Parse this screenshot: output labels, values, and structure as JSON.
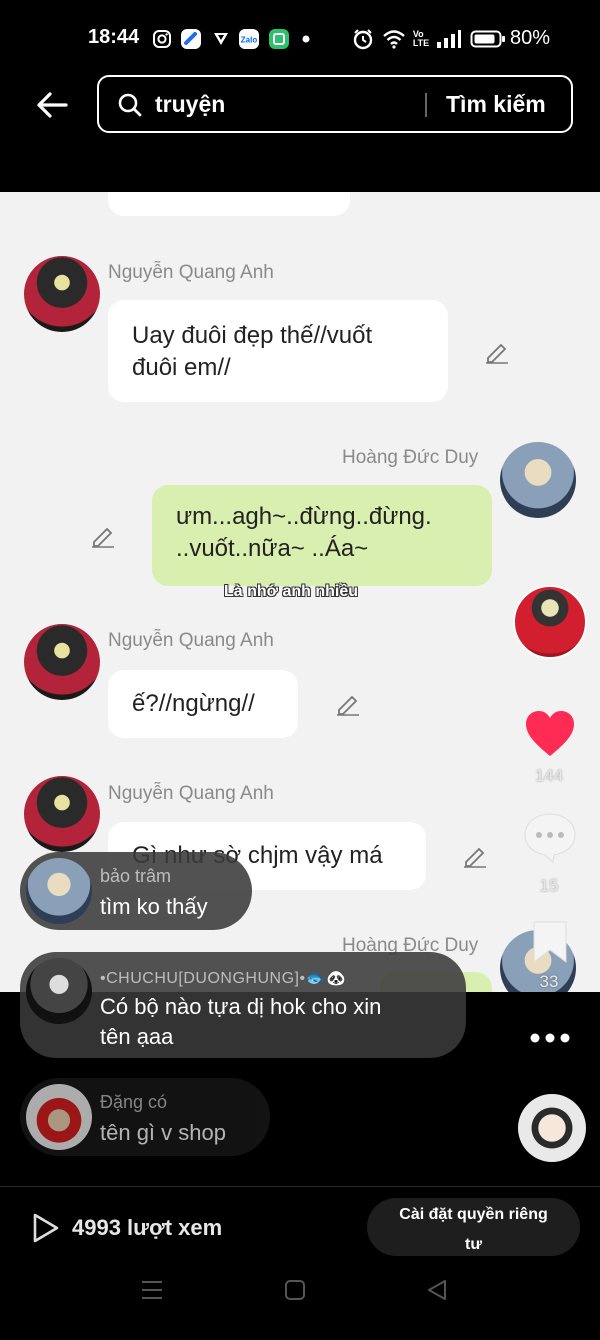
{
  "status_bar": {
    "time": "18:44",
    "icons": [
      "instagram-icon",
      "blue-app-icon",
      "vpn-heart-icon",
      "zalo-icon",
      "green-app-icon",
      "dot-icon",
      "alarm-icon",
      "wifi-icon",
      "volte-icon",
      "signal-icon",
      "battery-icon"
    ],
    "zalo_label": "Zalo",
    "volte_label": "Vo LTE",
    "battery": "80%"
  },
  "search": {
    "query": "truyện",
    "button": "Tìm kiếm"
  },
  "chat": {
    "messages": [
      {
        "sender": "Nguyễn Quang Anh",
        "text_line1": "Uay đuôi đẹp thế//vuốt",
        "text_line2": "đuôi em//"
      },
      {
        "sender": "Hoàng Đức Duy",
        "text_line1": "ưm...agh~..đừng..đừng.",
        "text_line2": "..vuốt..nữa~ ..Áa~"
      },
      {
        "sender": "Nguyễn Quang Anh",
        "text_line1": "ế?//ngừng//"
      },
      {
        "sender": "Nguyễn Quang Anh",
        "text_line1": "Gì như sờ chjm vậy má"
      },
      {
        "sender": "Hoàng Đức Duy"
      }
    ],
    "subtitle": "Là nhớ anh nhiều"
  },
  "rail": {
    "likes": "144",
    "comments": "15",
    "saves": "33"
  },
  "comments": [
    {
      "user": "bảo trâm",
      "text": "tìm ko thấy"
    },
    {
      "user": "•CHUCHU[DUONGHUNG]•🐟🐼",
      "text_line1": "Có bộ nào tựa dị hok cho xin",
      "text_line2": "tên ạaa"
    },
    {
      "user": "Đặng có",
      "text": "tên gì v shop"
    }
  ],
  "footer": {
    "views": "4993 lượt xem",
    "privacy_line1": "Cài đặt quyền riêng",
    "privacy_line2": "tư"
  },
  "colors": {
    "like_red": "#fe2c55",
    "chat_bg": "#f2f2f3",
    "green_bubble": "#d9efb0"
  }
}
